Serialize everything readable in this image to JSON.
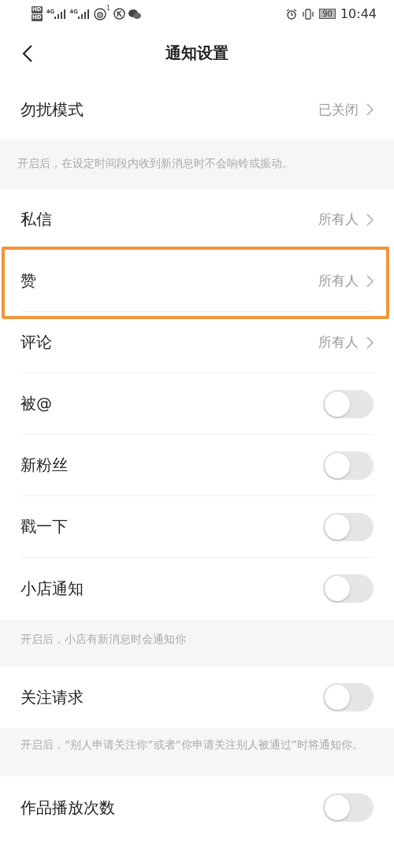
{
  "status_bar": {
    "sim_labels": [
      "HD",
      "HD"
    ],
    "network_labels": [
      "4G",
      "4G"
    ],
    "hotspot_count": "1",
    "battery": "90",
    "time": "10:44"
  },
  "nav": {
    "title": "通知设置"
  },
  "sections": [
    {
      "rows": [
        {
          "kind": "value",
          "label": "勿扰模式",
          "value": "已关闭",
          "highlighted": false
        }
      ],
      "note": "开启后，在设定时间段内收到新消息时不会响铃或振动。"
    },
    {
      "rows": [
        {
          "kind": "value",
          "label": "私信",
          "value": "所有人",
          "highlighted": false
        },
        {
          "kind": "value",
          "label": "赞",
          "value": "所有人",
          "highlighted": true
        },
        {
          "kind": "value",
          "label": "评论",
          "value": "所有人",
          "highlighted": false
        },
        {
          "kind": "toggle",
          "label": "被@",
          "on": false
        },
        {
          "kind": "toggle",
          "label": "新粉丝",
          "on": false
        },
        {
          "kind": "toggle",
          "label": "戳一下",
          "on": false
        },
        {
          "kind": "toggle",
          "label": "小店通知",
          "on": false
        }
      ],
      "note": "开启后，小店有新消息时会通知你"
    },
    {
      "rows": [
        {
          "kind": "toggle",
          "label": "关注请求",
          "on": false
        }
      ],
      "note": "开启后，“别人申请关注你”或者“你申请关注别人被通过”时将通知你。"
    },
    {
      "rows": [
        {
          "kind": "toggle",
          "label": "作品播放次数",
          "on": false
        }
      ]
    }
  ]
}
